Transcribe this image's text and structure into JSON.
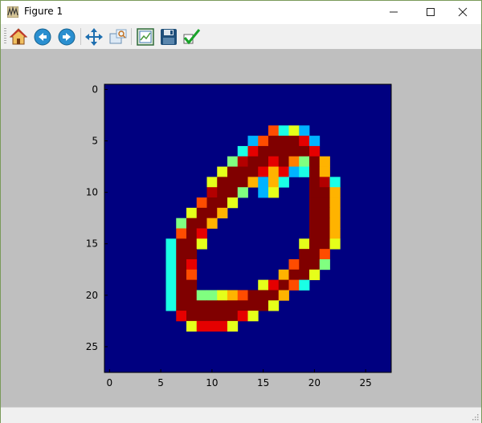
{
  "window": {
    "title": "Figure 1",
    "controls": {
      "minimize": "—",
      "maximize": "☐",
      "close": "✕"
    }
  },
  "toolbar": {
    "buttons": [
      {
        "name": "home-button",
        "icon": "home-icon"
      },
      {
        "name": "back-button",
        "icon": "back-arrow-icon"
      },
      {
        "name": "forward-button",
        "icon": "forward-arrow-icon"
      },
      {
        "name": "pan-button",
        "icon": "pan-move-icon"
      },
      {
        "name": "zoom-button",
        "icon": "zoom-rect-icon"
      },
      {
        "name": "subplots-button",
        "icon": "subplots-config-icon"
      },
      {
        "name": "save-button",
        "icon": "save-disk-icon"
      },
      {
        "name": "edit-axes-button",
        "icon": "checkmark-icon"
      }
    ]
  },
  "chart_data": {
    "type": "heatmap",
    "colormap": "jet",
    "xlim": [
      -0.5,
      27.5
    ],
    "ylim": [
      27.5,
      -0.5
    ],
    "xticks": [
      "0",
      "5",
      "10",
      "15",
      "20",
      "25"
    ],
    "yticks": [
      "0",
      "5",
      "10",
      "15",
      "20",
      "25"
    ],
    "grid": false,
    "description_shape": "handwritten digit zero (MNIST style)",
    "pixels": [
      [
        4,
        16,
        0.8
      ],
      [
        4,
        17,
        0.4
      ],
      [
        4,
        18,
        0.6
      ],
      [
        4,
        19,
        0.3
      ],
      [
        5,
        14,
        0.3
      ],
      [
        5,
        15,
        0.8
      ],
      [
        5,
        16,
        1
      ],
      [
        5,
        17,
        1
      ],
      [
        5,
        18,
        1
      ],
      [
        5,
        19,
        0.9
      ],
      [
        5,
        20,
        0.3
      ],
      [
        6,
        13,
        0.4
      ],
      [
        6,
        14,
        0.9
      ],
      [
        6,
        15,
        1
      ],
      [
        6,
        16,
        1
      ],
      [
        6,
        17,
        1
      ],
      [
        6,
        18,
        1
      ],
      [
        6,
        19,
        1
      ],
      [
        6,
        20,
        0.9
      ],
      [
        7,
        12,
        0.5
      ],
      [
        7,
        13,
        0.95
      ],
      [
        7,
        14,
        1
      ],
      [
        7,
        15,
        1
      ],
      [
        7,
        16,
        0.9
      ],
      [
        7,
        17,
        1
      ],
      [
        7,
        18,
        0.75
      ],
      [
        7,
        19,
        0.5
      ],
      [
        7,
        20,
        1
      ],
      [
        7,
        21,
        0.7
      ],
      [
        8,
        11,
        0.6
      ],
      [
        8,
        12,
        1
      ],
      [
        8,
        13,
        1
      ],
      [
        8,
        14,
        1
      ],
      [
        8,
        15,
        0.9
      ],
      [
        8,
        16,
        0.7
      ],
      [
        8,
        17,
        0.9
      ],
      [
        8,
        18,
        0.3
      ],
      [
        8,
        19,
        0.4
      ],
      [
        8,
        20,
        1
      ],
      [
        8,
        21,
        0.7
      ],
      [
        9,
        10,
        0.6
      ],
      [
        9,
        11,
        1
      ],
      [
        9,
        12,
        1
      ],
      [
        9,
        13,
        1
      ],
      [
        9,
        14,
        0.7
      ],
      [
        9,
        15,
        0.3
      ],
      [
        9,
        16,
        0.7
      ],
      [
        9,
        17,
        0.4
      ],
      [
        9,
        20,
        1
      ],
      [
        9,
        21,
        0.95
      ],
      [
        9,
        22,
        0.4
      ],
      [
        10,
        10,
        0.95
      ],
      [
        10,
        11,
        1
      ],
      [
        10,
        12,
        1
      ],
      [
        10,
        13,
        0.5
      ],
      [
        10,
        15,
        0.3
      ],
      [
        10,
        16,
        0.6
      ],
      [
        10,
        20,
        1
      ],
      [
        10,
        21,
        1
      ],
      [
        10,
        22,
        0.7
      ],
      [
        11,
        9,
        0.8
      ],
      [
        11,
        10,
        1
      ],
      [
        11,
        11,
        1
      ],
      [
        11,
        12,
        0.6
      ],
      [
        11,
        20,
        1
      ],
      [
        11,
        21,
        1
      ],
      [
        11,
        22,
        0.7
      ],
      [
        12,
        8,
        0.6
      ],
      [
        12,
        9,
        1
      ],
      [
        12,
        10,
        1
      ],
      [
        12,
        11,
        0.7
      ],
      [
        12,
        20,
        1
      ],
      [
        12,
        21,
        1
      ],
      [
        12,
        22,
        0.7
      ],
      [
        13,
        7,
        0.5
      ],
      [
        13,
        8,
        1
      ],
      [
        13,
        9,
        1
      ],
      [
        13,
        10,
        0.7
      ],
      [
        13,
        20,
        1
      ],
      [
        13,
        21,
        1
      ],
      [
        13,
        22,
        0.7
      ],
      [
        14,
        7,
        0.8
      ],
      [
        14,
        8,
        1
      ],
      [
        14,
        9,
        0.9
      ],
      [
        14,
        20,
        1
      ],
      [
        14,
        21,
        1
      ],
      [
        14,
        22,
        0.7
      ],
      [
        15,
        6,
        0.4
      ],
      [
        15,
        7,
        1
      ],
      [
        15,
        8,
        1
      ],
      [
        15,
        9,
        0.6
      ],
      [
        15,
        19,
        0.6
      ],
      [
        15,
        20,
        1
      ],
      [
        15,
        21,
        1
      ],
      [
        15,
        22,
        0.6
      ],
      [
        16,
        6,
        0.4
      ],
      [
        16,
        7,
        1
      ],
      [
        16,
        8,
        1
      ],
      [
        16,
        19,
        1
      ],
      [
        16,
        20,
        1
      ],
      [
        16,
        21,
        0.8
      ],
      [
        17,
        6,
        0.4
      ],
      [
        17,
        7,
        1
      ],
      [
        17,
        8,
        0.9
      ],
      [
        17,
        18,
        0.8
      ],
      [
        17,
        19,
        1
      ],
      [
        17,
        20,
        1
      ],
      [
        17,
        21,
        0.5
      ],
      [
        18,
        6,
        0.4
      ],
      [
        18,
        7,
        1
      ],
      [
        18,
        8,
        0.8
      ],
      [
        18,
        17,
        0.7
      ],
      [
        18,
        18,
        1
      ],
      [
        18,
        19,
        1
      ],
      [
        18,
        20,
        0.6
      ],
      [
        19,
        6,
        0.4
      ],
      [
        19,
        7,
        1
      ],
      [
        19,
        8,
        1
      ],
      [
        19,
        15,
        0.6
      ],
      [
        19,
        16,
        0.9
      ],
      [
        19,
        17,
        1
      ],
      [
        19,
        18,
        0.8
      ],
      [
        19,
        19,
        0.4
      ],
      [
        20,
        6,
        0.4
      ],
      [
        20,
        7,
        1
      ],
      [
        20,
        8,
        1
      ],
      [
        20,
        9,
        0.5
      ],
      [
        20,
        10,
        0.5
      ],
      [
        20,
        11,
        0.6
      ],
      [
        20,
        12,
        0.7
      ],
      [
        20,
        13,
        0.8
      ],
      [
        20,
        14,
        1
      ],
      [
        20,
        15,
        1
      ],
      [
        20,
        16,
        1
      ],
      [
        20,
        17,
        0.7
      ],
      [
        21,
        6,
        0.4
      ],
      [
        21,
        7,
        1
      ],
      [
        21,
        8,
        1
      ],
      [
        21,
        9,
        1
      ],
      [
        21,
        10,
        1
      ],
      [
        21,
        11,
        1
      ],
      [
        21,
        12,
        1
      ],
      [
        21,
        13,
        1
      ],
      [
        21,
        14,
        1
      ],
      [
        21,
        15,
        1
      ],
      [
        21,
        16,
        0.6
      ],
      [
        22,
        7,
        0.9
      ],
      [
        22,
        8,
        1
      ],
      [
        22,
        9,
        1
      ],
      [
        22,
        10,
        1
      ],
      [
        22,
        11,
        1
      ],
      [
        22,
        12,
        1
      ],
      [
        22,
        13,
        0.9
      ],
      [
        22,
        14,
        0.6
      ],
      [
        23,
        8,
        0.6
      ],
      [
        23,
        9,
        0.9
      ],
      [
        23,
        10,
        0.9
      ],
      [
        23,
        11,
        0.9
      ],
      [
        23,
        12,
        0.6
      ]
    ]
  }
}
